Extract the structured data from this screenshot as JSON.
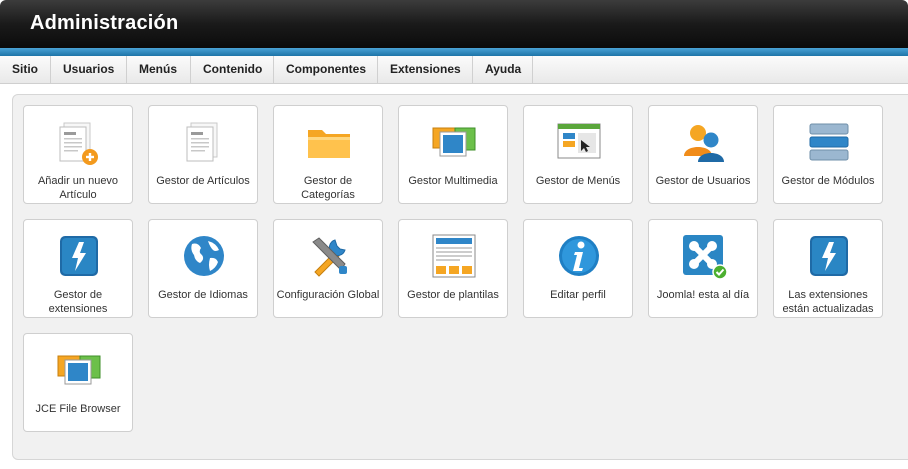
{
  "header": {
    "title": "Administración"
  },
  "menu": [
    "Sitio",
    "Usuarios",
    "Menús",
    "Contenido",
    "Componentes",
    "Extensiones",
    "Ayuda"
  ],
  "tiles": [
    {
      "label": "Añadir un nuevo Artículo",
      "icon": "add-article-icon"
    },
    {
      "label": "Gestor de Artículos",
      "icon": "article-manager-icon"
    },
    {
      "label": "Gestor de Categorías",
      "icon": "folder-icon"
    },
    {
      "label": "Gestor Multimedia",
      "icon": "media-icon"
    },
    {
      "label": "Gestor de Menús",
      "icon": "menu-manager-icon"
    },
    {
      "label": "Gestor de Usuarios",
      "icon": "users-icon"
    },
    {
      "label": "Gestor de Módulos",
      "icon": "modules-icon"
    },
    {
      "label": "Gestor de extensiones",
      "icon": "extensions-icon"
    },
    {
      "label": "Gestor de Idiomas",
      "icon": "globe-icon"
    },
    {
      "label": "Configuración Global",
      "icon": "tools-icon"
    },
    {
      "label": "Gestor de plantilas",
      "icon": "template-icon"
    },
    {
      "label": "Editar perfil",
      "icon": "info-icon"
    },
    {
      "label": "Joomla! esta al día",
      "icon": "joomla-ok-icon"
    },
    {
      "label": "Las extensiones están actualizadas",
      "icon": "extensions-updated-icon"
    },
    {
      "label": "JCE File Browser",
      "icon": "file-browser-icon"
    }
  ]
}
